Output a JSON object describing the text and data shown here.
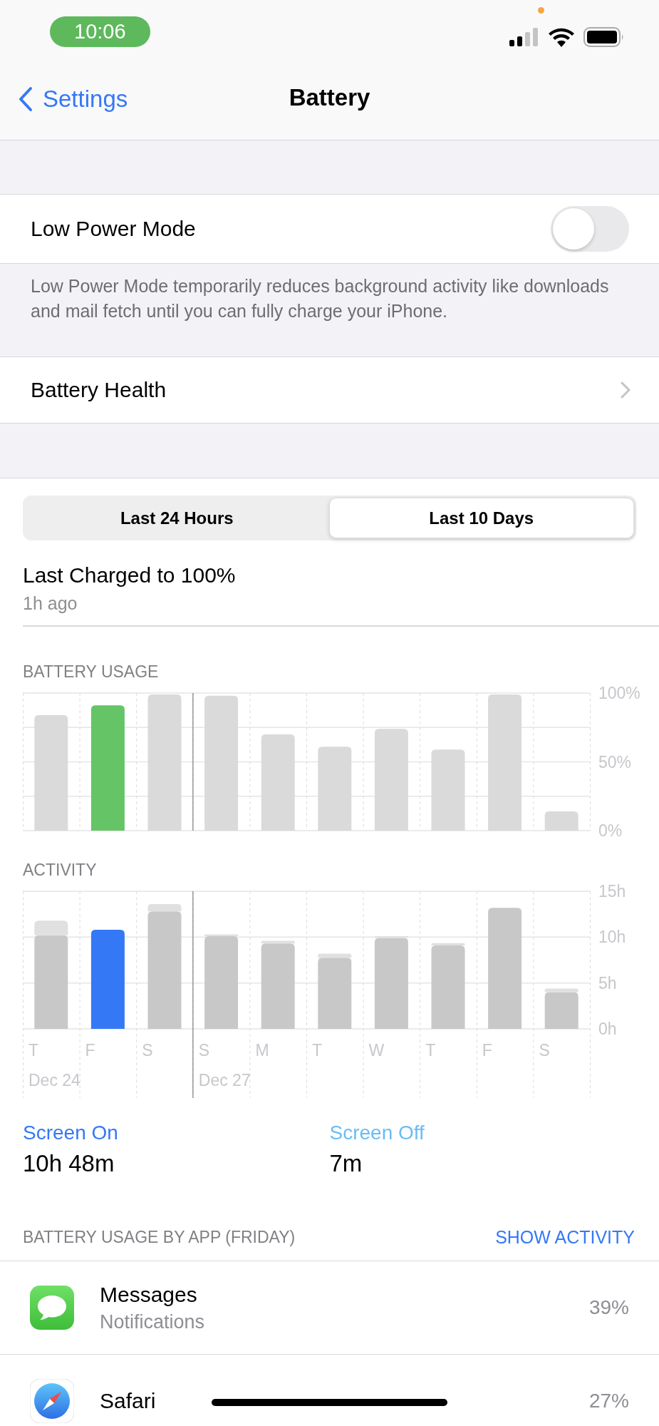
{
  "status_bar": {
    "time": "10:06"
  },
  "nav": {
    "back": "Settings",
    "title": "Battery"
  },
  "low_power": {
    "label": "Low Power Mode",
    "on": false,
    "footer": "Low Power Mode temporarily reduces background activity like downloads and mail fetch until you can fully charge your iPhone."
  },
  "battery_health": {
    "label": "Battery Health"
  },
  "tabs": [
    {
      "label": "Last 24 Hours",
      "selected": false
    },
    {
      "label": "Last 10 Days",
      "selected": true
    }
  ],
  "last_charged": {
    "title": "Last Charged to 100%",
    "time": "1h ago"
  },
  "battery_usage": {
    "heading": "BATTERY USAGE",
    "chart_data": {
      "type": "bar",
      "ylim": [
        0,
        100
      ],
      "yticks": [
        {
          "value": 0,
          "label": "0%"
        },
        {
          "value": 50,
          "label": "50%"
        },
        {
          "value": 100,
          "label": "100%"
        }
      ],
      "series": [
        {
          "color": "#dadada",
          "values": [
            84,
            null,
            99,
            98,
            70,
            61,
            74,
            59,
            99,
            14
          ]
        },
        {
          "color": "#65c466",
          "values": [
            null,
            91,
            null,
            null,
            null,
            null,
            null,
            null,
            null,
            null
          ]
        }
      ]
    }
  },
  "activity": {
    "heading": "ACTIVITY",
    "chart_data": {
      "type": "bar",
      "stacked": true,
      "ylim": [
        0,
        15
      ],
      "yticks": [
        {
          "value": 0,
          "label": "0h"
        },
        {
          "value": 5,
          "label": "5h"
        },
        {
          "value": 10,
          "label": "10h"
        },
        {
          "value": 15,
          "label": "15h"
        }
      ],
      "series": [
        {
          "color": "#c8c8c8",
          "values": [
            10.2,
            null,
            12.8,
            10.1,
            9.3,
            7.75,
            9.9,
            9.1,
            13.2,
            4.0
          ]
        },
        {
          "color": "#3478f6",
          "values": [
            null,
            10.8,
            null,
            null,
            null,
            null,
            null,
            null,
            null,
            null
          ]
        },
        {
          "color": "#e0e0e0",
          "values": [
            1.6,
            null,
            0.8,
            0.2,
            0.3,
            0.45,
            0.2,
            0.25,
            null,
            0.4
          ]
        }
      ]
    },
    "weeks": [
      {
        "date": "Dec 24",
        "days": [
          "T",
          "F",
          "S"
        ]
      },
      {
        "date": "Dec 27",
        "days": [
          "S",
          "M",
          "T",
          "W",
          "T",
          "F",
          "S"
        ]
      }
    ]
  },
  "totals": [
    {
      "label": "Screen On",
      "value": "10h 48m",
      "color": "#3478f6"
    },
    {
      "label": "Screen Off",
      "value": "7m",
      "color": "#6bbcf5"
    }
  ],
  "apps_header": {
    "title": "BATTERY USAGE BY APP (FRIDAY)",
    "action": "SHOW ACTIVITY"
  },
  "apps": [
    {
      "name": "Messages",
      "detail": "Notifications",
      "percent": "39%"
    },
    {
      "name": "Safari",
      "percent": "27%"
    }
  ]
}
